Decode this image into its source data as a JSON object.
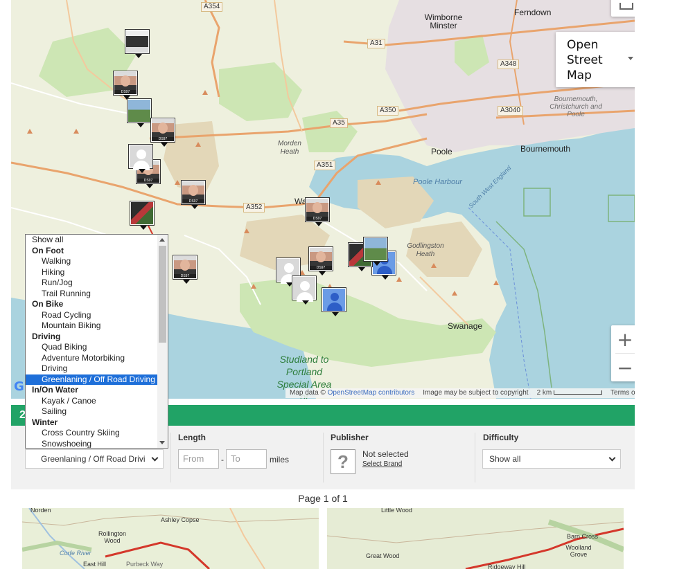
{
  "map": {
    "roads": [
      "A354",
      "A31",
      "A348",
      "A350",
      "A35",
      "A3040",
      "A351",
      "A352"
    ],
    "towns": [
      "Wimborne Minster",
      "Ferndown",
      "Poole",
      "Bournemouth",
      "Swanage",
      "Wa"
    ],
    "places": [
      "Morden Heath",
      "Godlingston Heath"
    ],
    "water": [
      "Poole Harbour",
      "South West England"
    ],
    "greyplace": [
      "Bournemouth, Christchurch and Poole"
    ],
    "protected": [
      "Studland to Portland Special Area of"
    ],
    "map_type": {
      "label_line1": "Open",
      "label_line2": "Street",
      "label_line3": "Map"
    },
    "zoom_in": "+",
    "zoom_out": "−",
    "attribution": {
      "map_data": "Map data ©",
      "osm": "OpenStreetMap contributors",
      "copyright": "Image may be subject to copyright",
      "scale": "2 km",
      "terms": "Terms of Use"
    },
    "marker_tag": "DS97",
    "google_logo_letter": "G"
  },
  "results_bar": {
    "prefix": "2"
  },
  "filters": {
    "activity": {
      "selected": "Greenlaning / Off Road Drivi"
    },
    "length": {
      "label": "Length",
      "from_placeholder": "From",
      "dash": "-",
      "to_placeholder": "To",
      "unit": "miles"
    },
    "publisher": {
      "label": "Publisher",
      "status": "Not selected",
      "select_brand": "Select Brand",
      "icon_glyph": "?"
    },
    "difficulty": {
      "label": "Difficulty",
      "selected": "Show all"
    }
  },
  "dropdown": {
    "options": [
      {
        "label": "Show all",
        "kind": "opt"
      },
      {
        "label": "On Foot",
        "kind": "grp"
      },
      {
        "label": "Walking",
        "kind": "sub"
      },
      {
        "label": "Hiking",
        "kind": "sub"
      },
      {
        "label": "Run/Jog",
        "kind": "sub"
      },
      {
        "label": "Trail Running",
        "kind": "sub"
      },
      {
        "label": "On Bike",
        "kind": "grp"
      },
      {
        "label": "Road Cycling",
        "kind": "sub"
      },
      {
        "label": "Mountain Biking",
        "kind": "sub"
      },
      {
        "label": "Driving",
        "kind": "grp"
      },
      {
        "label": "Quad Biking",
        "kind": "sub"
      },
      {
        "label": "Adventure Motorbiking",
        "kind": "sub"
      },
      {
        "label": "Driving",
        "kind": "sub"
      },
      {
        "label": "Greenlaning / Off Road Driving",
        "kind": "sub",
        "selected": true
      },
      {
        "label": "In/On Water",
        "kind": "grp"
      },
      {
        "label": "Kayak / Canoe",
        "kind": "sub"
      },
      {
        "label": "Sailing",
        "kind": "sub"
      },
      {
        "label": "Winter",
        "kind": "grp"
      },
      {
        "label": "Cross Country Skiing",
        "kind": "sub"
      },
      {
        "label": "Snowshoeing",
        "kind": "sub"
      }
    ]
  },
  "pagination": {
    "text": "Page 1 of 1"
  },
  "thumb_maps": [
    {
      "labels": [
        "Norden",
        "Ashley Copse",
        "Rollington Wood",
        "Corfe River",
        "East Hill",
        "Purbeck Way"
      ]
    },
    {
      "labels": [
        "Little Wood",
        "Barn Cross",
        "Great Wood",
        "Woolland Grove",
        "Ridgeway Hill"
      ]
    }
  ],
  "colors": {
    "accent_green": "#21a366",
    "selected_blue": "#1e6fd9",
    "route_red": "#d4382b"
  }
}
